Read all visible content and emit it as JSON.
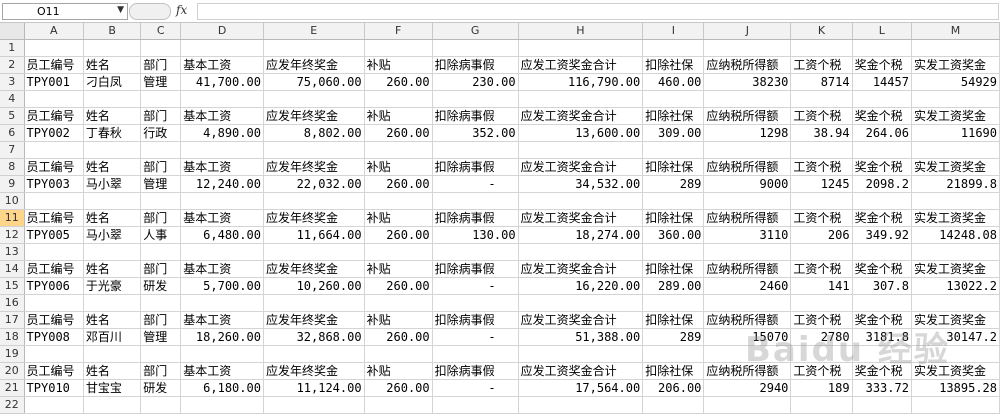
{
  "formula_bar": {
    "name_box": "O11",
    "fx_label": "fx",
    "formula": ""
  },
  "columns": [
    "A",
    "B",
    "C",
    "D",
    "E",
    "F",
    "G",
    "H",
    "I",
    "J",
    "K",
    "L",
    "M"
  ],
  "rows": [
    {
      "n": "1",
      "cells": [
        "",
        "",
        "",
        "",
        "",
        "",
        "",
        "",
        "",
        "",
        "",
        "",
        ""
      ]
    },
    {
      "n": "2",
      "cells": [
        "员工编号",
        "姓名",
        "部门",
        "基本工资",
        "应发年终奖金",
        "补贴",
        "扣除病事假",
        "应发工资奖金合计",
        "扣除社保",
        "应纳税所得额",
        "工资个税",
        "奖金个税",
        "实发工资奖金"
      ]
    },
    {
      "n": "3",
      "cells": [
        "TPY001",
        "刁白凤",
        "管理",
        "41,700.00",
        "75,060.00",
        "260.00",
        "230.00",
        "116,790.00",
        "460.00",
        "38230",
        "8714",
        "14457",
        "54929"
      ]
    },
    {
      "n": "4",
      "cells": [
        "",
        "",
        "",
        "",
        "",
        "",
        "",
        "",
        "",
        "",
        "",
        "",
        ""
      ]
    },
    {
      "n": "5",
      "cells": [
        "员工编号",
        "姓名",
        "部门",
        "基本工资",
        "应发年终奖金",
        "补贴",
        "扣除病事假",
        "应发工资奖金合计",
        "扣除社保",
        "应纳税所得额",
        "工资个税",
        "奖金个税",
        "实发工资奖金"
      ]
    },
    {
      "n": "6",
      "cells": [
        "TPY002",
        "丁春秋",
        "行政",
        "4,890.00",
        "8,802.00",
        "260.00",
        "352.00",
        "13,600.00",
        "309.00",
        "1298",
        "38.94",
        "264.06",
        "11690"
      ]
    },
    {
      "n": "7",
      "cells": [
        "",
        "",
        "",
        "",
        "",
        "",
        "",
        "",
        "",
        "",
        "",
        "",
        ""
      ]
    },
    {
      "n": "8",
      "cells": [
        "员工编号",
        "姓名",
        "部门",
        "基本工资",
        "应发年终奖金",
        "补贴",
        "扣除病事假",
        "应发工资奖金合计",
        "扣除社保",
        "应纳税所得额",
        "工资个税",
        "奖金个税",
        "实发工资奖金"
      ]
    },
    {
      "n": "9",
      "cells": [
        "TPY003",
        "马小翠",
        "管理",
        "12,240.00",
        "22,032.00",
        "260.00",
        "-",
        "34,532.00",
        "289",
        "9000",
        "1245",
        "2098.2",
        "21899.8"
      ]
    },
    {
      "n": "10",
      "cells": [
        "",
        "",
        "",
        "",
        "",
        "",
        "",
        "",
        "",
        "",
        "",
        "",
        ""
      ]
    },
    {
      "n": "11",
      "cells": [
        "员工编号",
        "姓名",
        "部门",
        "基本工资",
        "应发年终奖金",
        "补贴",
        "扣除病事假",
        "应发工资奖金合计",
        "扣除社保",
        "应纳税所得额",
        "工资个税",
        "奖金个税",
        "实发工资奖金"
      ]
    },
    {
      "n": "12",
      "cells": [
        "TPY005",
        "马小翠",
        "人事",
        "6,480.00",
        "11,664.00",
        "260.00",
        "130.00",
        "18,274.00",
        "360.00",
        "3110",
        "206",
        "349.92",
        "14248.08"
      ]
    },
    {
      "n": "13",
      "cells": [
        "",
        "",
        "",
        "",
        "",
        "",
        "",
        "",
        "",
        "",
        "",
        "",
        ""
      ]
    },
    {
      "n": "14",
      "cells": [
        "员工编号",
        "姓名",
        "部门",
        "基本工资",
        "应发年终奖金",
        "补贴",
        "扣除病事假",
        "应发工资奖金合计",
        "扣除社保",
        "应纳税所得额",
        "工资个税",
        "奖金个税",
        "实发工资奖金"
      ]
    },
    {
      "n": "15",
      "cells": [
        "TPY006",
        "于光豪",
        "研发",
        "5,700.00",
        "10,260.00",
        "260.00",
        "-",
        "16,220.00",
        "289.00",
        "2460",
        "141",
        "307.8",
        "13022.2"
      ]
    },
    {
      "n": "16",
      "cells": [
        "",
        "",
        "",
        "",
        "",
        "",
        "",
        "",
        "",
        "",
        "",
        "",
        ""
      ]
    },
    {
      "n": "17",
      "cells": [
        "员工编号",
        "姓名",
        "部门",
        "基本工资",
        "应发年终奖金",
        "补贴",
        "扣除病事假",
        "应发工资奖金合计",
        "扣除社保",
        "应纳税所得额",
        "工资个税",
        "奖金个税",
        "实发工资奖金"
      ]
    },
    {
      "n": "18",
      "cells": [
        "TPY008",
        "邓百川",
        "管理",
        "18,260.00",
        "32,868.00",
        "260.00",
        "-",
        "51,388.00",
        "289",
        "15070",
        "2780",
        "3181.8",
        "30147.2"
      ]
    },
    {
      "n": "19",
      "cells": [
        "",
        "",
        "",
        "",
        "",
        "",
        "",
        "",
        "",
        "",
        "",
        "",
        ""
      ]
    },
    {
      "n": "20",
      "cells": [
        "员工编号",
        "姓名",
        "部门",
        "基本工资",
        "应发年终奖金",
        "补贴",
        "扣除病事假",
        "应发工资奖金合计",
        "扣除社保",
        "应纳税所得额",
        "工资个税",
        "奖金个税",
        "实发工资奖金"
      ]
    },
    {
      "n": "21",
      "cells": [
        "TPY010",
        "甘宝宝",
        "研发",
        "6,180.00",
        "11,124.00",
        "260.00",
        "-",
        "17,564.00",
        "206.00",
        "2940",
        "189",
        "333.72",
        "13895.28"
      ]
    },
    {
      "n": "22",
      "cells": [
        "",
        "",
        "",
        "",
        "",
        "",
        "",
        "",
        "",
        "",
        "",
        "",
        ""
      ]
    }
  ],
  "selected_row": "11",
  "watermark": "Baidu 经验"
}
